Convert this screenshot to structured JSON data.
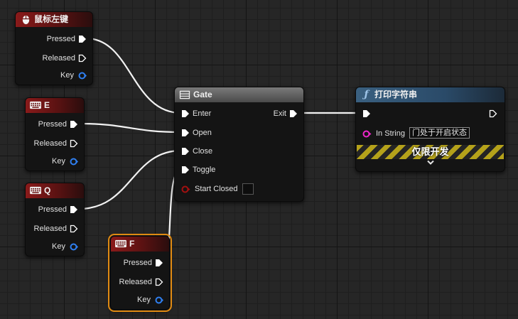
{
  "nodes": {
    "mouse": {
      "title": "鼠标左键",
      "pressed": "Pressed",
      "released": "Released",
      "key": "Key"
    },
    "key_e": {
      "title": "E",
      "pressed": "Pressed",
      "released": "Released",
      "key": "Key"
    },
    "key_q": {
      "title": "Q",
      "pressed": "Pressed",
      "released": "Released",
      "key": "Key"
    },
    "key_f": {
      "title": "F",
      "pressed": "Pressed",
      "released": "Released",
      "key": "Key"
    },
    "gate": {
      "title": "Gate",
      "enter": "Enter",
      "open": "Open",
      "close": "Close",
      "toggle": "Toggle",
      "start_closed": "Start Closed",
      "exit": "Exit"
    },
    "print": {
      "title": "打印字符串",
      "in_string_label": "In String",
      "in_string_value": "门处于开启状态",
      "dev_only": "仅限开发"
    }
  },
  "colors": {
    "exec_pin": "#ffffff",
    "key_pin": "#2f7ff0",
    "string_pin": "#ee26c9",
    "bool_pin": "#a31010",
    "selected_outline": "#e08a12"
  },
  "icons": {
    "mouse": "mouse-icon",
    "keyboard": "keyboard-icon",
    "gate": "gate-icon",
    "function": "function-icon"
  }
}
